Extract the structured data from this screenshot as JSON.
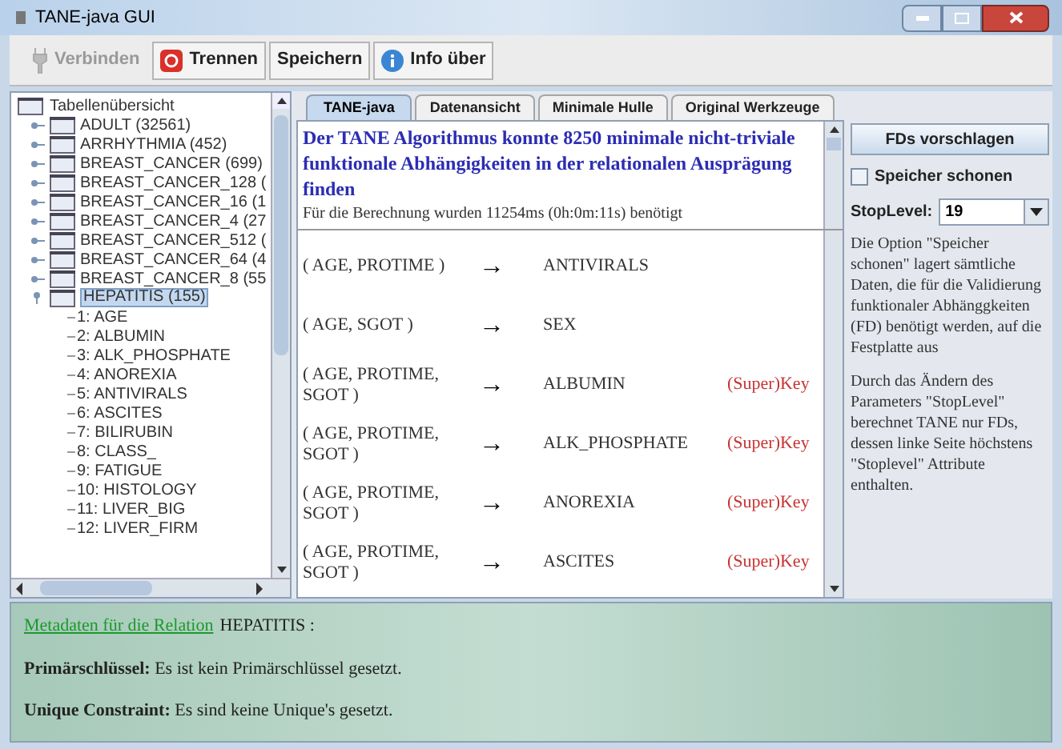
{
  "window": {
    "title": "TANE-java GUI"
  },
  "toolbar": [
    {
      "kind": "plug",
      "label": "Verbinden",
      "disabled": true
    },
    {
      "kind": "stop",
      "label": "Trennen",
      "disabled": false
    },
    {
      "kind": "none",
      "label": "Speichern",
      "disabled": false
    },
    {
      "kind": "info",
      "label": "Info über",
      "disabled": false
    }
  ],
  "tree": {
    "label": "Tabellenübersicht",
    "children": [
      {
        "label": "ADULT (32561)",
        "expanded": false,
        "selected": false
      },
      {
        "label": "ARRHYTHMIA (452)",
        "expanded": false,
        "selected": false
      },
      {
        "label": "BREAST_CANCER (699)",
        "expanded": false,
        "selected": false
      },
      {
        "label": "BREAST_CANCER_128 (",
        "expanded": false,
        "selected": false
      },
      {
        "label": "BREAST_CANCER_16 (1",
        "expanded": false,
        "selected": false
      },
      {
        "label": "BREAST_CANCER_4 (27",
        "expanded": false,
        "selected": false
      },
      {
        "label": "BREAST_CANCER_512 (",
        "expanded": false,
        "selected": false
      },
      {
        "label": "BREAST_CANCER_64 (4",
        "expanded": false,
        "selected": false
      },
      {
        "label": "BREAST_CANCER_8 (55",
        "expanded": false,
        "selected": false
      },
      {
        "label": "HEPATITIS (155)",
        "expanded": true,
        "selected": true,
        "children": [
          {
            "label": "1: AGE"
          },
          {
            "label": "2: ALBUMIN"
          },
          {
            "label": "3: ALK_PHOSPHATE"
          },
          {
            "label": "4: ANOREXIA"
          },
          {
            "label": "5: ANTIVIRALS"
          },
          {
            "label": "6: ASCITES"
          },
          {
            "label": "7: BILIRUBIN"
          },
          {
            "label": "8: CLASS_"
          },
          {
            "label": "9: FATIGUE"
          },
          {
            "label": "10: HISTOLOGY"
          },
          {
            "label": "11: LIVER_BIG"
          },
          {
            "label": "12: LIVER_FIRM"
          }
        ]
      }
    ]
  },
  "tabs": [
    {
      "label": "TANE-java",
      "selected": true
    },
    {
      "label": "Datenansicht",
      "selected": false
    },
    {
      "label": "Minimale Hulle",
      "selected": false
    },
    {
      "label": "Original Werkzeuge",
      "selected": false
    }
  ],
  "result": {
    "headline": "Der TANE Algorithmus konnte 8250 minimale nicht-triviale funktionale Abhängigkeiten in der relationalen Ausprägung finden",
    "timing": "Für die Berechnung wurden 11254ms (0h:0m:11s) benötigt",
    "rows": [
      {
        "lhs": "( AGE, PROTIME )",
        "arrow": "→",
        "rhs": "ANTIVIRALS"
      },
      {
        "lhs": "( AGE, SGOT )",
        "arrow": "→",
        "rhs": "SEX"
      },
      {
        "lhs": "( AGE, PROTIME, SGOT )",
        "arrow": "→",
        "rhs": "ALBUMIN",
        "key": "(Super)Key"
      },
      {
        "lhs": "( AGE, PROTIME, SGOT )",
        "arrow": "→",
        "rhs": "ALK_PHOSPHATE",
        "key": "(Super)Key"
      },
      {
        "lhs": "( AGE, PROTIME, SGOT )",
        "arrow": "→",
        "rhs": "ANOREXIA",
        "key": "(Super)Key"
      },
      {
        "lhs": "( AGE, PROTIME, SGOT )",
        "arrow": "→",
        "rhs": "ASCITES",
        "key": "(Super)Key"
      }
    ]
  },
  "options": {
    "button": "FDs vorschlagen",
    "save_memory": {
      "label": "Speicher schonen",
      "checked": false
    },
    "stoplevel": {
      "label": "StopLevel:",
      "value": "19"
    },
    "descriptions": [
      "Die Option \"Speicher schonen\" lagert sämtliche Daten, die für die Validierung funktionaler Abhänggkeiten (FD) benötigt werden, auf die Festplatte aus",
      "Durch das Ändern des Parameters \"StopLevel\" berechnet TANE nur FDs, dessen linke Seite höchstens \"Stoplevel\" Attribute enthalten."
    ]
  },
  "metadata": {
    "link": "Metadaten für die Relation",
    "relation": "HEPATITIS :",
    "lines": [
      {
        "label": "Primärschlüssel:",
        "text": "Es ist kein Primärschlüssel gesetzt."
      },
      {
        "label": "Unique Constraint:",
        "text": "Es sind keine Unique's gesetzt."
      }
    ]
  }
}
